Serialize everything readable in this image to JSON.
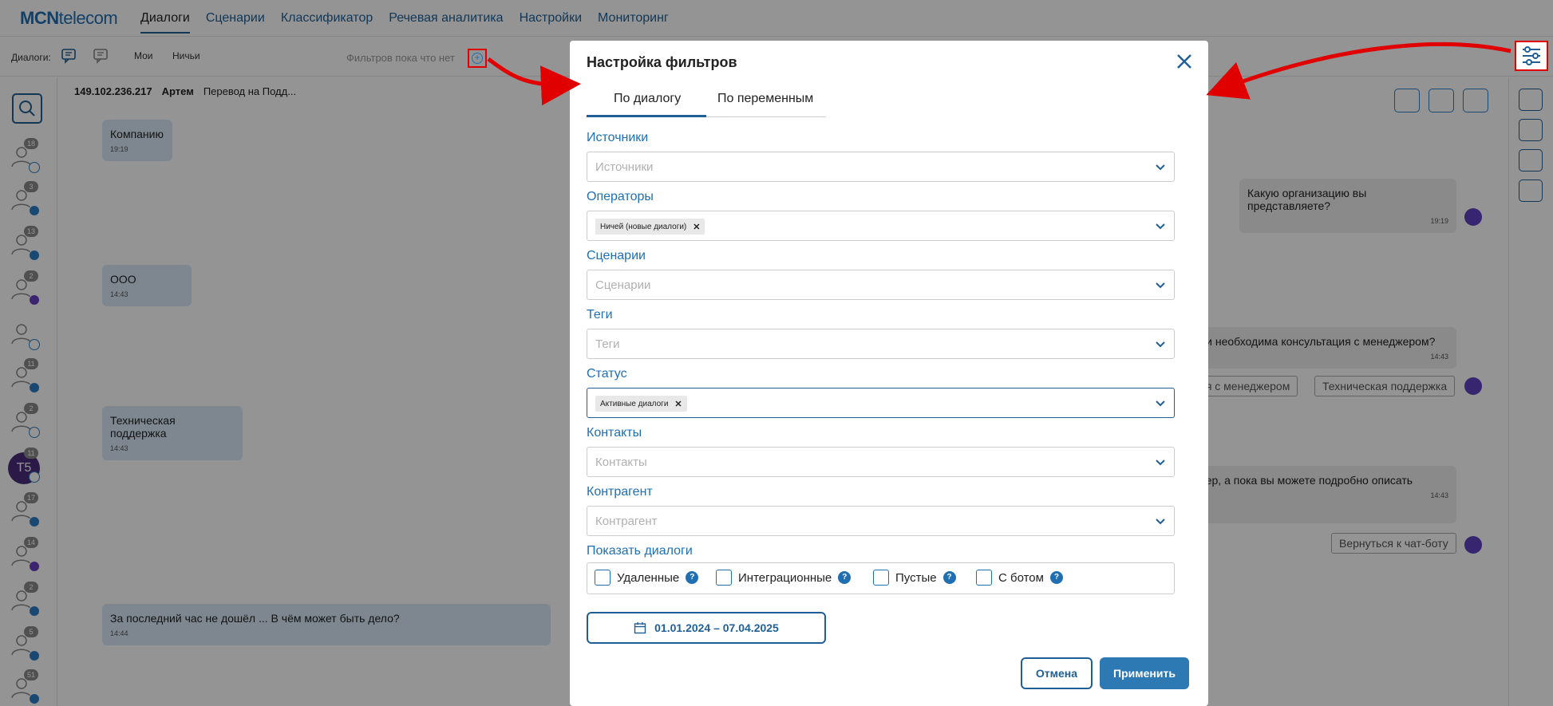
{
  "brand": {
    "mcn": "MCN",
    "telecom": "telecom"
  },
  "nav": {
    "items": [
      "Диалоги",
      "Сценарии",
      "Классификатор",
      "Речевая аналитика",
      "Настройки",
      "Мониторинг"
    ],
    "active_index": 0
  },
  "toolbar": {
    "dialogs_label": "Диалоги:",
    "mine_label": "Мои",
    "nobody_label": "Ничьи",
    "no_filters": "Фильтров пока что нет"
  },
  "contacts": {
    "badges": [
      "18",
      "3",
      "13",
      "2",
      "",
      "11",
      "2",
      "11",
      "17",
      "14",
      "2",
      "5",
      "51"
    ],
    "t5_initials": "T5"
  },
  "chat": {
    "ip": "149.102.236.217",
    "operator": "Артем",
    "scenario": "Перевод на Подд...",
    "messages_user": [
      {
        "text": "Компанию",
        "time": "19:19"
      },
      {
        "text": "ООО",
        "time": "14:43"
      },
      {
        "text": "Техническая поддержка",
        "time": "14:43"
      },
      {
        "text": "За последний час не дошёл ... В чём может быть дело?",
        "time": "14:44"
      }
    ],
    "messages_bot": [
      {
        "text": "Какую организацию вы представляете?",
        "time": "19:19"
      },
      {
        "text": "ли необходима консультация с менеджером?",
        "time": "14:43"
      },
      {
        "text": "нер, а пока вы можете подробно описать",
        "time": "14:43"
      }
    ],
    "bot_buttons": [
      "ия с менеджером",
      "Техническая поддержка",
      "Вернуться к чат-боту"
    ]
  },
  "modal": {
    "title": "Настройка фильтров",
    "tabs": [
      "По диалогу",
      "По переменным"
    ],
    "fields": [
      {
        "label": "Источники",
        "placeholder": "Источники"
      },
      {
        "label": "Операторы",
        "tag": "Ничей (новые диалоги)"
      },
      {
        "label": "Сценарии",
        "placeholder": "Сценарии"
      },
      {
        "label": "Теги",
        "placeholder": "Теги"
      },
      {
        "label": "Статус",
        "tag": "Активные диалоги"
      },
      {
        "label": "Контакты",
        "placeholder": "Контакты"
      },
      {
        "label": "Контрагент",
        "placeholder": "Контрагент"
      }
    ],
    "show_label": "Показать диалоги",
    "checks": [
      "Удаленные",
      "Интеграционные",
      "Пустые",
      "С ботом"
    ],
    "help_glyph": "?",
    "date_range": "01.01.2024 – 07.04.2025",
    "cancel": "Отмена",
    "apply": "Применить"
  },
  "colors": {
    "accent": "#1f5f96",
    "link": "#1f6fb2",
    "highlight": "#e00000",
    "apply_bg": "#2d79b3"
  }
}
